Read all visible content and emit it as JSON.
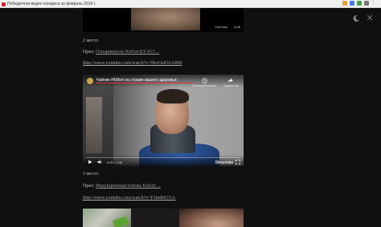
{
  "browser": {
    "tab_title": "Победители видео конкурса за февраль 2019 г.",
    "colors": {
      "tab_favicon": "#d22233"
    }
  },
  "viewer": {
    "icons": {
      "theme_toggle": "moon-icon",
      "close": "close-icon"
    },
    "close_glyph": "✕"
  },
  "video_top": {
    "youtube_label": "YouTube",
    "time": "3:08"
  },
  "entries": [
    {
      "place": "2 место",
      "prize_label": "Приз:",
      "prize_link": "Отпариватель Kitfort КТ-913 ...",
      "url": "http://www.youtube.com/watch?v=9boOsIO2ABM"
    },
    {
      "place": "3 место",
      "prize_label": "Приз:",
      "prize_link": "Индукционная плитка Kitfort ...",
      "url": "http://www.youtube.com/watch?v=Fzhek0GGA"
    }
  ],
  "video_main": {
    "title": "Чайник #Kitfort на страже вашего здоровья",
    "watch_later": "Посмотреть позже",
    "share": "Поделиться",
    "time": "0:00 / 1:36",
    "progress": 0.0,
    "youtube_label": "YouTube",
    "colors": {
      "progress": "#ff0000",
      "jacket": "#2e5ba8"
    }
  }
}
